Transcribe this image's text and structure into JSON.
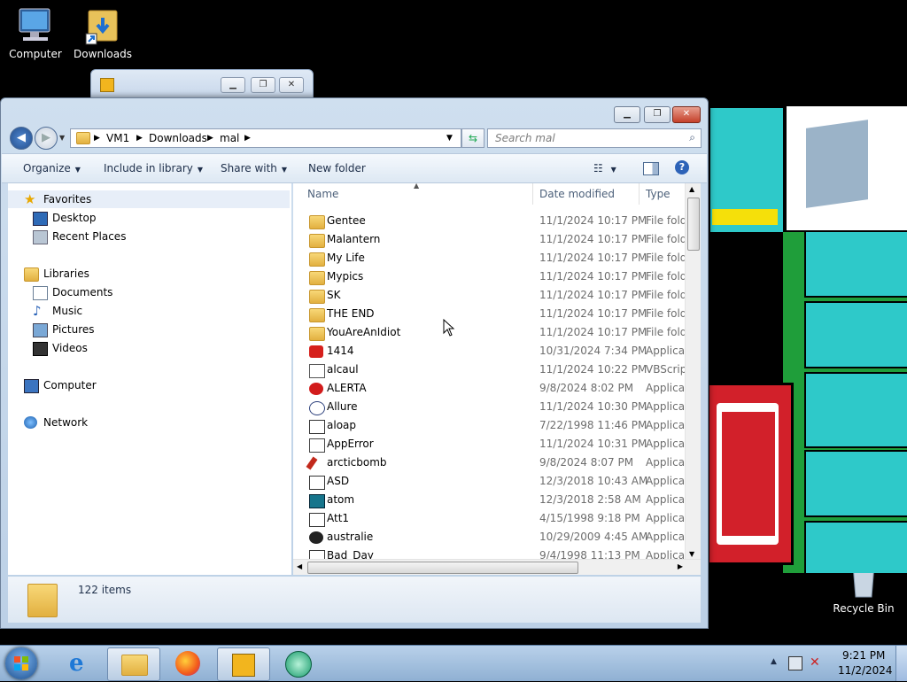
{
  "desktop": {
    "icons": [
      {
        "label": "Computer"
      },
      {
        "label": "Downloads"
      },
      {
        "label": "Recycle Bin"
      }
    ]
  },
  "explorer": {
    "breadcrumb": [
      "VM1",
      "Downloads",
      "mal"
    ],
    "search_placeholder": "Search mal",
    "toolbar": {
      "organize": "Organize",
      "include_in_library": "Include in library",
      "share_with": "Share with",
      "new_folder": "New folder"
    },
    "nav": {
      "favorites": "Favorites",
      "desktop": "Desktop",
      "recent_places": "Recent Places",
      "libraries": "Libraries",
      "documents": "Documents",
      "music": "Music",
      "pictures": "Pictures",
      "videos": "Videos",
      "computer": "Computer",
      "network": "Network"
    },
    "columns": {
      "name": "Name",
      "date_modified": "Date modified",
      "type": "Type"
    },
    "files": [
      {
        "name": "Gentee",
        "date": "11/1/2024 10:17 PM",
        "type": "File folder",
        "icon": "folder-icon"
      },
      {
        "name": "Malantern",
        "date": "11/1/2024 10:17 PM",
        "type": "File folder",
        "icon": "folder-icon"
      },
      {
        "name": "My Life",
        "date": "11/1/2024 10:17 PM",
        "type": "File folder",
        "icon": "folder-icon"
      },
      {
        "name": "Mypics",
        "date": "11/1/2024 10:17 PM",
        "type": "File folder",
        "icon": "folder-icon"
      },
      {
        "name": "SK",
        "date": "11/1/2024 10:17 PM",
        "type": "File folder",
        "icon": "folder-icon"
      },
      {
        "name": "THE END",
        "date": "11/1/2024 10:17 PM",
        "type": "File folder",
        "icon": "folder-icon"
      },
      {
        "name": "YouAreAnIdiot",
        "date": "11/1/2024 10:17 PM",
        "type": "File folder",
        "icon": "folder-icon"
      },
      {
        "name": "1414",
        "date": "10/31/2024 7:34 PM",
        "type": "Application",
        "icon": "red-bug-icon"
      },
      {
        "name": "alcaul",
        "date": "11/1/2024 10:22 PM",
        "type": "VBScript Script File",
        "icon": "script-icon"
      },
      {
        "name": "ALERTA",
        "date": "9/8/2024 8:02 PM",
        "type": "Application",
        "icon": "stop-sign-icon"
      },
      {
        "name": "Allure",
        "date": "11/1/2024 10:30 PM",
        "type": "Application",
        "icon": "atom-icon"
      },
      {
        "name": "aloap",
        "date": "7/22/1998 11:46 PM",
        "type": "Application",
        "icon": "app-window-icon"
      },
      {
        "name": "AppError",
        "date": "11/1/2024 10:31 PM",
        "type": "Application",
        "icon": "app-error-icon"
      },
      {
        "name": "arcticbomb",
        "date": "9/8/2024 8:07 PM",
        "type": "Application",
        "icon": "dynamite-icon"
      },
      {
        "name": "ASD",
        "date": "12/3/2018 10:43 AM",
        "type": "Application",
        "icon": "app-window-icon"
      },
      {
        "name": "atom",
        "date": "12/3/2018 2:58 AM",
        "type": "Application",
        "icon": "atom-app-icon"
      },
      {
        "name": "Att1",
        "date": "4/15/1998 9:18 PM",
        "type": "Application",
        "icon": "app-window-icon"
      },
      {
        "name": "australie",
        "date": "10/29/2009 4:45 AM",
        "type": "Application",
        "icon": "bug-icon"
      },
      {
        "name": "Bad_Day",
        "date": "9/4/1998 11:13 PM",
        "type": "Application",
        "icon": "app-window-icon"
      }
    ],
    "status_count": "122 items"
  },
  "taskbar": {
    "time": "9:21 PM",
    "date": "11/2/2024"
  }
}
